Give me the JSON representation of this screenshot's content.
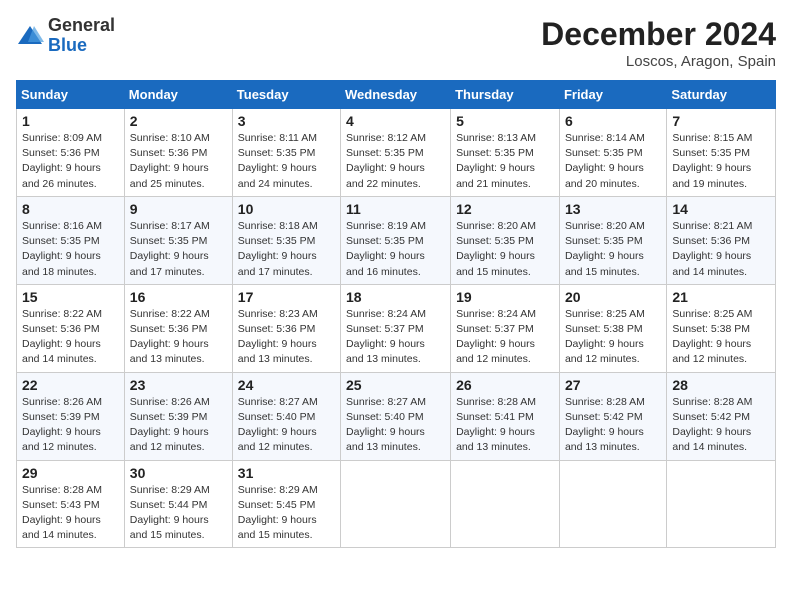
{
  "header": {
    "logo": {
      "line1": "General",
      "line2": "Blue"
    },
    "title": "December 2024",
    "location": "Loscos, Aragon, Spain"
  },
  "weekdays": [
    "Sunday",
    "Monday",
    "Tuesday",
    "Wednesday",
    "Thursday",
    "Friday",
    "Saturday"
  ],
  "weeks": [
    [
      {
        "day": "1",
        "sunrise": "Sunrise: 8:09 AM",
        "sunset": "Sunset: 5:36 PM",
        "daylight": "Daylight: 9 hours and 26 minutes."
      },
      {
        "day": "2",
        "sunrise": "Sunrise: 8:10 AM",
        "sunset": "Sunset: 5:36 PM",
        "daylight": "Daylight: 9 hours and 25 minutes."
      },
      {
        "day": "3",
        "sunrise": "Sunrise: 8:11 AM",
        "sunset": "Sunset: 5:35 PM",
        "daylight": "Daylight: 9 hours and 24 minutes."
      },
      {
        "day": "4",
        "sunrise": "Sunrise: 8:12 AM",
        "sunset": "Sunset: 5:35 PM",
        "daylight": "Daylight: 9 hours and 22 minutes."
      },
      {
        "day": "5",
        "sunrise": "Sunrise: 8:13 AM",
        "sunset": "Sunset: 5:35 PM",
        "daylight": "Daylight: 9 hours and 21 minutes."
      },
      {
        "day": "6",
        "sunrise": "Sunrise: 8:14 AM",
        "sunset": "Sunset: 5:35 PM",
        "daylight": "Daylight: 9 hours and 20 minutes."
      },
      {
        "day": "7",
        "sunrise": "Sunrise: 8:15 AM",
        "sunset": "Sunset: 5:35 PM",
        "daylight": "Daylight: 9 hours and 19 minutes."
      }
    ],
    [
      {
        "day": "8",
        "sunrise": "Sunrise: 8:16 AM",
        "sunset": "Sunset: 5:35 PM",
        "daylight": "Daylight: 9 hours and 18 minutes."
      },
      {
        "day": "9",
        "sunrise": "Sunrise: 8:17 AM",
        "sunset": "Sunset: 5:35 PM",
        "daylight": "Daylight: 9 hours and 17 minutes."
      },
      {
        "day": "10",
        "sunrise": "Sunrise: 8:18 AM",
        "sunset": "Sunset: 5:35 PM",
        "daylight": "Daylight: 9 hours and 17 minutes."
      },
      {
        "day": "11",
        "sunrise": "Sunrise: 8:19 AM",
        "sunset": "Sunset: 5:35 PM",
        "daylight": "Daylight: 9 hours and 16 minutes."
      },
      {
        "day": "12",
        "sunrise": "Sunrise: 8:20 AM",
        "sunset": "Sunset: 5:35 PM",
        "daylight": "Daylight: 9 hours and 15 minutes."
      },
      {
        "day": "13",
        "sunrise": "Sunrise: 8:20 AM",
        "sunset": "Sunset: 5:35 PM",
        "daylight": "Daylight: 9 hours and 15 minutes."
      },
      {
        "day": "14",
        "sunrise": "Sunrise: 8:21 AM",
        "sunset": "Sunset: 5:36 PM",
        "daylight": "Daylight: 9 hours and 14 minutes."
      }
    ],
    [
      {
        "day": "15",
        "sunrise": "Sunrise: 8:22 AM",
        "sunset": "Sunset: 5:36 PM",
        "daylight": "Daylight: 9 hours and 14 minutes."
      },
      {
        "day": "16",
        "sunrise": "Sunrise: 8:22 AM",
        "sunset": "Sunset: 5:36 PM",
        "daylight": "Daylight: 9 hours and 13 minutes."
      },
      {
        "day": "17",
        "sunrise": "Sunrise: 8:23 AM",
        "sunset": "Sunset: 5:36 PM",
        "daylight": "Daylight: 9 hours and 13 minutes."
      },
      {
        "day": "18",
        "sunrise": "Sunrise: 8:24 AM",
        "sunset": "Sunset: 5:37 PM",
        "daylight": "Daylight: 9 hours and 13 minutes."
      },
      {
        "day": "19",
        "sunrise": "Sunrise: 8:24 AM",
        "sunset": "Sunset: 5:37 PM",
        "daylight": "Daylight: 9 hours and 12 minutes."
      },
      {
        "day": "20",
        "sunrise": "Sunrise: 8:25 AM",
        "sunset": "Sunset: 5:38 PM",
        "daylight": "Daylight: 9 hours and 12 minutes."
      },
      {
        "day": "21",
        "sunrise": "Sunrise: 8:25 AM",
        "sunset": "Sunset: 5:38 PM",
        "daylight": "Daylight: 9 hours and 12 minutes."
      }
    ],
    [
      {
        "day": "22",
        "sunrise": "Sunrise: 8:26 AM",
        "sunset": "Sunset: 5:39 PM",
        "daylight": "Daylight: 9 hours and 12 minutes."
      },
      {
        "day": "23",
        "sunrise": "Sunrise: 8:26 AM",
        "sunset": "Sunset: 5:39 PM",
        "daylight": "Daylight: 9 hours and 12 minutes."
      },
      {
        "day": "24",
        "sunrise": "Sunrise: 8:27 AM",
        "sunset": "Sunset: 5:40 PM",
        "daylight": "Daylight: 9 hours and 12 minutes."
      },
      {
        "day": "25",
        "sunrise": "Sunrise: 8:27 AM",
        "sunset": "Sunset: 5:40 PM",
        "daylight": "Daylight: 9 hours and 13 minutes."
      },
      {
        "day": "26",
        "sunrise": "Sunrise: 8:28 AM",
        "sunset": "Sunset: 5:41 PM",
        "daylight": "Daylight: 9 hours and 13 minutes."
      },
      {
        "day": "27",
        "sunrise": "Sunrise: 8:28 AM",
        "sunset": "Sunset: 5:42 PM",
        "daylight": "Daylight: 9 hours and 13 minutes."
      },
      {
        "day": "28",
        "sunrise": "Sunrise: 8:28 AM",
        "sunset": "Sunset: 5:42 PM",
        "daylight": "Daylight: 9 hours and 14 minutes."
      }
    ],
    [
      {
        "day": "29",
        "sunrise": "Sunrise: 8:28 AM",
        "sunset": "Sunset: 5:43 PM",
        "daylight": "Daylight: 9 hours and 14 minutes."
      },
      {
        "day": "30",
        "sunrise": "Sunrise: 8:29 AM",
        "sunset": "Sunset: 5:44 PM",
        "daylight": "Daylight: 9 hours and 15 minutes."
      },
      {
        "day": "31",
        "sunrise": "Sunrise: 8:29 AM",
        "sunset": "Sunset: 5:45 PM",
        "daylight": "Daylight: 9 hours and 15 minutes."
      },
      null,
      null,
      null,
      null
    ]
  ]
}
